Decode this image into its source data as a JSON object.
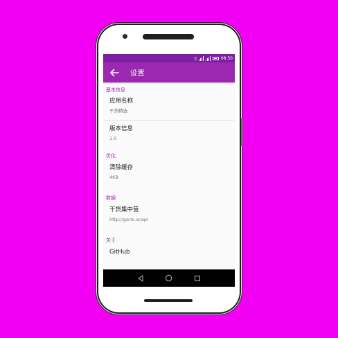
{
  "status_bar": {
    "time": "08:50",
    "icons": [
      "vibrate-icon",
      "signal-icon",
      "signal-icon",
      "battery-icon"
    ]
  },
  "toolbar": {
    "title": "设置",
    "back_icon": "arrow-left-icon"
  },
  "sections": [
    {
      "header": "基本信息",
      "items": [
        {
          "title": "应用名称",
          "summary": "干货精选"
        },
        {
          "title": "版本信息",
          "summary": "1.0"
        }
      ]
    },
    {
      "header": "优化",
      "items": [
        {
          "title": "清除缓存",
          "summary": "4KB"
        }
      ]
    },
    {
      "header": "数据",
      "items": [
        {
          "title": "干货集中营",
          "summary": "http://gank.io/api"
        }
      ]
    },
    {
      "header": "关于",
      "items": [
        {
          "title": "GitHub",
          "summary": ""
        }
      ]
    }
  ],
  "nav_bar": {
    "icons": [
      "back-triangle-icon",
      "home-circle-icon",
      "recents-square-icon"
    ]
  },
  "colors": {
    "background": "#f200f4",
    "primary": "#9c27b0",
    "primary_dark": "#7c1fa3",
    "accent": "#9c27b0"
  }
}
